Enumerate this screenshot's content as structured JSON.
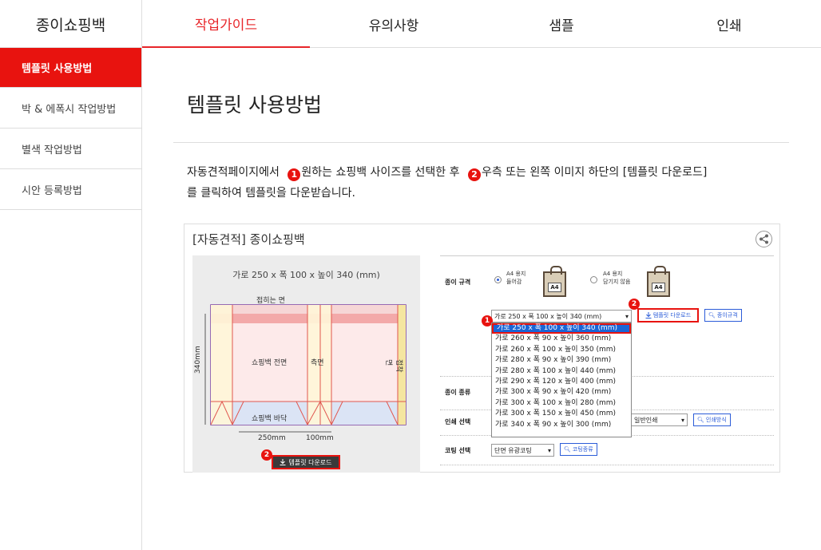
{
  "header": {
    "brand": "종이쇼핑백",
    "tabs": [
      {
        "label": "작업가이드",
        "active": true
      },
      {
        "label": "유의사항"
      },
      {
        "label": "샘플"
      },
      {
        "label": "인쇄"
      }
    ]
  },
  "sidebar": {
    "items": [
      {
        "label": "템플릿 사용방법",
        "active": true
      },
      {
        "label": "박 & 에폭시 작업방법"
      },
      {
        "label": "별색 작업방법"
      },
      {
        "label": "시안 등록방법"
      }
    ]
  },
  "main": {
    "title": "템플릿 사용방법",
    "desc": {
      "part1": "자동견적페이지에서",
      "num1": "1",
      "part2": "원하는 쇼핑백 사이즈를 선택한 후",
      "num2": "2",
      "part3": "우측 또는 왼쪽 이미지 하단의 [템플릿 다운로드]",
      "line2": "를 클릭하여 템플릿을 다운받습니다."
    }
  },
  "panel": {
    "title": "[자동견적] 종이쇼핑백",
    "left": {
      "size_label": "가로 250 x 폭 100 x 높이 340 (mm)",
      "fold_label": "접히는 면",
      "front_label": "쇼핑백 전면",
      "side_label": "측면",
      "bottom_label": "쇼핑백 바닥",
      "glue_label": "접착면",
      "height_label": "340mm",
      "width_label": "250mm",
      "depth_label": "100mm",
      "download_label": "템플릿 다운로드",
      "badge": "2"
    },
    "right": {
      "paper_size_label": "종이 규격",
      "option1": "A4 용지 들어감",
      "option1_a": "A4 용지",
      "option1_b": "들어감",
      "option2_a": "A4 용지",
      "option2_b": "담기지 않음",
      "bag_text": "A4",
      "selected_size": "가로 250 x 폭 100 x 높이 340 (mm)",
      "download_label": "템플릿 다운로드",
      "paper_spec_btn": "종이규격",
      "badge1": "1",
      "badge2": "2",
      "paper_type_label": "종이 종류",
      "print_label": "인쇄 선택",
      "print_value": "일반인쇄",
      "print_btn": "인쇄방식",
      "coating_label": "코팅 선택",
      "coating_value": "단면 유광코팅",
      "coating_btn": "코팅종류",
      "sizes": [
        "가로 250 x 폭 100 x 높이 340 (mm)",
        "가로 260 x 폭 90 x 높이 360 (mm)",
        "가로 260 x 폭 100 x 높이 350 (mm)",
        "가로 280 x 폭 90 x 높이 390 (mm)",
        "가로 280 x 폭 100 x 높이 440 (mm)",
        "가로 290 x 폭 120 x 높이 400 (mm)",
        "가로 300 x 폭 90 x 높이 420 (mm)",
        "가로 300 x 폭 100 x 높이 280 (mm)",
        "가로 300 x 폭 150 x 높이 450 (mm)",
        "가로 340 x 폭 90 x 높이 300 (mm)"
      ]
    }
  },
  "colors": {
    "accent": "#e8130f",
    "link": "#2b5cd8"
  }
}
